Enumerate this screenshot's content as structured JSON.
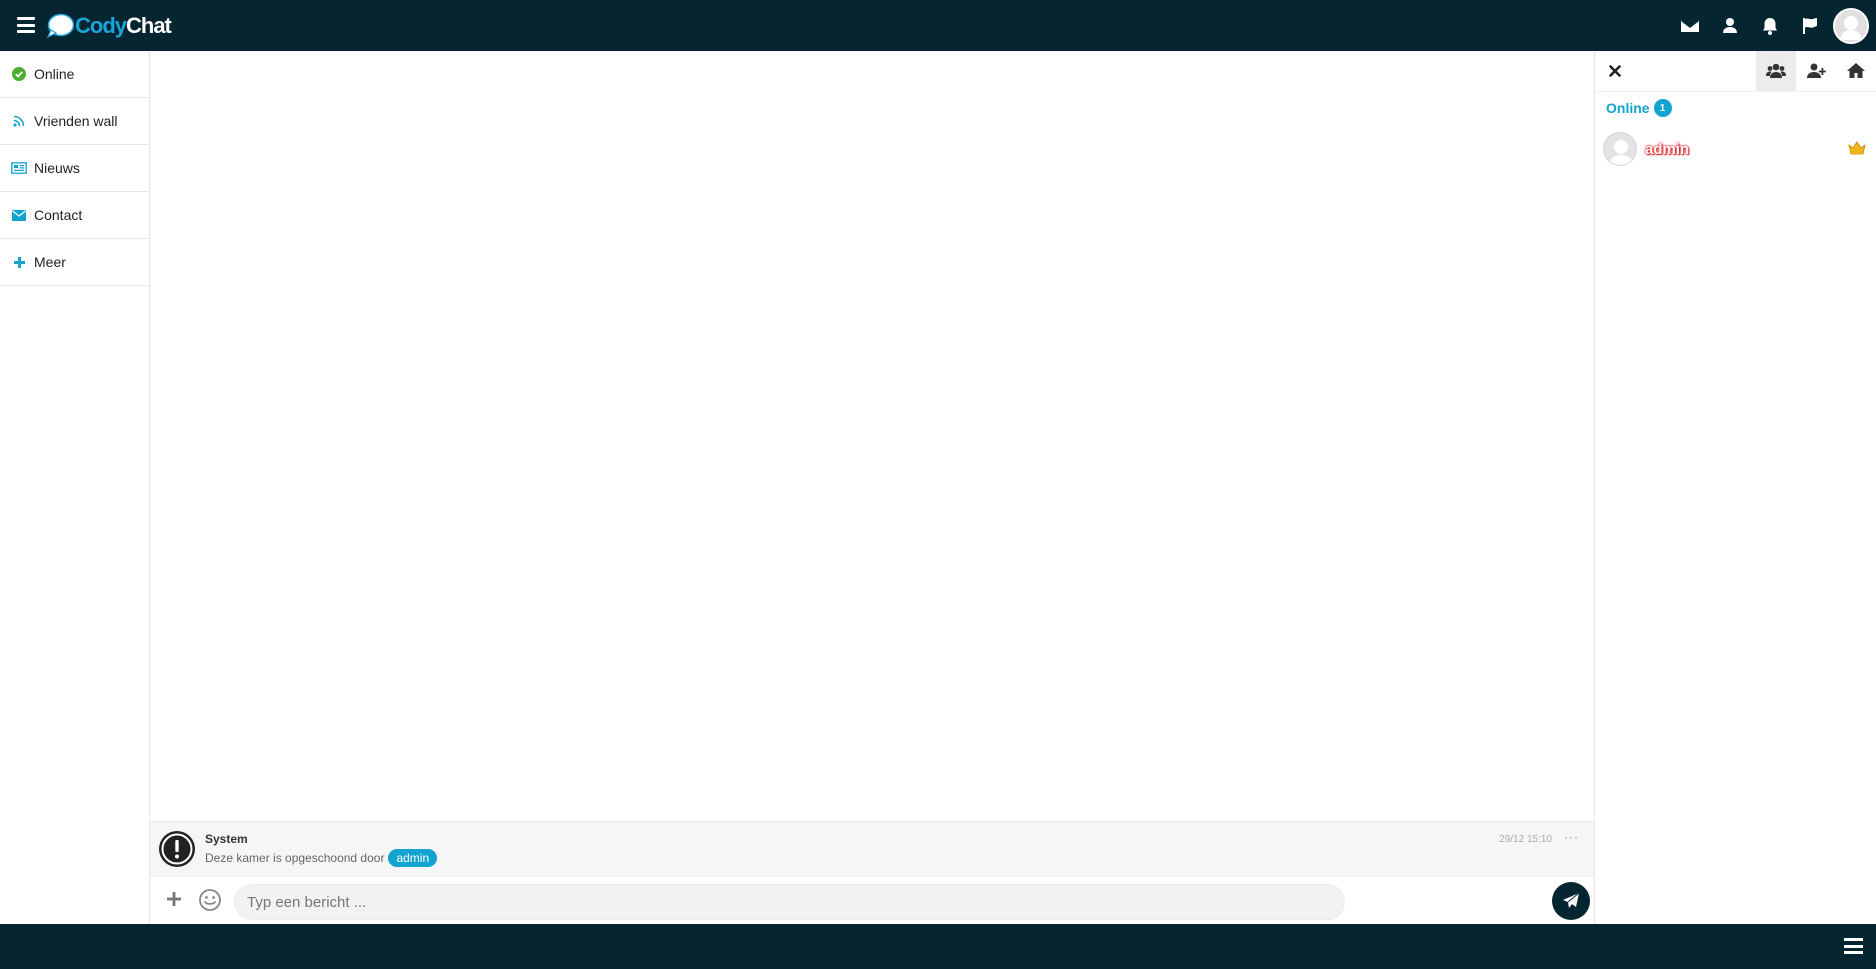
{
  "header": {
    "logo_cody": "Cody",
    "logo_chat": "Chat",
    "icons": [
      "menu-icon",
      "envelope-icon",
      "user-icon",
      "bell-icon",
      "flag-icon",
      "avatar"
    ]
  },
  "sidebar": {
    "items": [
      {
        "label": "Online",
        "icon": "check-circle-icon",
        "color": "#4caf32"
      },
      {
        "label": "Vrienden wall",
        "icon": "rss-icon",
        "color": "#12a4cf"
      },
      {
        "label": "Nieuws",
        "icon": "newspaper-icon",
        "color": "#12a4cf"
      },
      {
        "label": "Contact",
        "icon": "envelope-icon",
        "color": "#12a4cf"
      },
      {
        "label": "Meer",
        "icon": "plus-icon",
        "color": "#12a4cf"
      }
    ]
  },
  "chat": {
    "message": {
      "author": "System",
      "text": "Deze kamer is opgeschoond door",
      "mention": "admin",
      "time": "29/12 15:10",
      "more": "···"
    },
    "input": {
      "placeholder": "Typ een bericht ..."
    }
  },
  "right_panel": {
    "online_label": "Online",
    "online_count": "1",
    "users": [
      {
        "name": "admin",
        "rank_icon": "crown-icon"
      }
    ]
  },
  "colors": {
    "topbar": "#052630",
    "accent": "#12a4cf",
    "username": "#e0222a"
  }
}
